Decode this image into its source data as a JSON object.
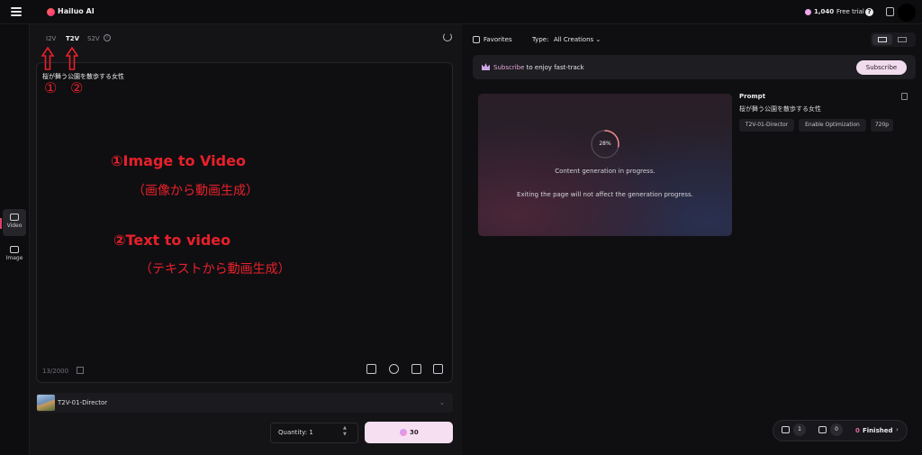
{
  "header": {
    "logo_text": "Hailuo AI",
    "credits": "1,040",
    "free_trial": "Free trial",
    "help_glyph": "?"
  },
  "rail": {
    "items": [
      {
        "label": "Video",
        "icon": "video-icon",
        "active": true
      },
      {
        "label": "Image",
        "icon": "image-icon",
        "active": false
      }
    ]
  },
  "tabs": {
    "items": [
      "I2V",
      "T2V",
      "S2V"
    ],
    "active": "T2V",
    "info_glyph": "i"
  },
  "prompt": {
    "text": "桜が舞う公園を散歩する女性",
    "char_count": "13/2000"
  },
  "annotations": {
    "marker1": "①",
    "marker2": "②",
    "line1": "①Image to Video",
    "line1_sub": "（画像から動画生成）",
    "line2": "②Text to video",
    "line2_sub": "（テキストから動画生成）",
    "color": "#e8202a"
  },
  "model": {
    "name": "T2V-01-Director",
    "chevron": "⌄"
  },
  "quantity": {
    "label": "Quantity: 1",
    "up": "▲",
    "down": "▼"
  },
  "generate": {
    "cost": "30"
  },
  "toolbar": {
    "favorites": "Favorites",
    "type_label": "Type:",
    "type_value": "All Creations ⌄"
  },
  "subscribe_bar": {
    "link": "Subscribe",
    "text": " to enjoy fast-track",
    "button": "Subscribe"
  },
  "task": {
    "progress_percent": 28,
    "progress_label": "28%",
    "message": "Content generation in progress.",
    "message2": "Exiting the page will not affect the generation progress.",
    "prompt_title": "Prompt",
    "prompt_text": "桜が舞う公園を散歩する女性",
    "tags": [
      "T2V-01-Director",
      "Enable Optimization",
      "720p"
    ]
  },
  "queue": {
    "running": "1",
    "pending": "0",
    "finished_count": "0",
    "finished_label": "Finished",
    "chevron": "›"
  },
  "colors": {
    "accent": "#e26aa6",
    "annotation": "#e8202a",
    "button_bg": "#f5dff0"
  }
}
